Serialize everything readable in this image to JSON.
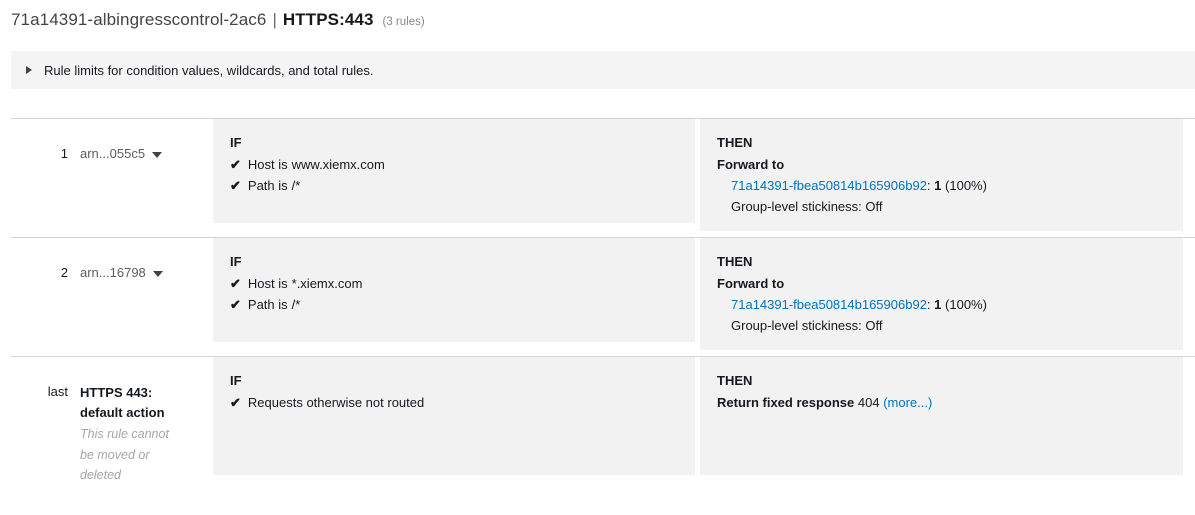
{
  "header": {
    "listener_name": "71a14391-albingresscontrol-2ac6",
    "separator": "|",
    "protocol_port": "HTTPS:443",
    "rules_count": "(3 rules)"
  },
  "info_banner": {
    "icon": "disclosure-triangle-icon",
    "text": "Rule limits for condition values, wildcards, and total rules."
  },
  "labels": {
    "if": "IF",
    "then": "THEN",
    "check_glyph": "✔"
  },
  "rules": [
    {
      "index": "1",
      "arn": "arn...055c5",
      "conditions": [
        {
          "key": "Host is",
          "value": "www.xiemx.com"
        },
        {
          "key": "Path is",
          "value": "/*"
        }
      ],
      "action_label": "Forward to",
      "target_group": "71a14391-fbea50814b165906b92",
      "target_colon": ":",
      "target_weight": "1",
      "target_percent": "(100%)",
      "stickiness": "Group-level stickiness: Off"
    },
    {
      "index": "2",
      "arn": "arn...16798",
      "conditions": [
        {
          "key": "Host is",
          "value": "*.xiemx.com"
        },
        {
          "key": "Path is",
          "value": "/*"
        }
      ],
      "action_label": "Forward to",
      "target_group": "71a14391-fbea50814b165906b92",
      "target_colon": ":",
      "target_weight": "1",
      "target_percent": "(100%)",
      "stickiness": "Group-level stickiness: Off"
    }
  ],
  "default_rule": {
    "index": "last",
    "title": "HTTPS 443: default action",
    "note": "This rule cannot be moved or deleted",
    "condition": "Requests otherwise not routed",
    "action_label": "Return fixed response",
    "action_code": "404",
    "more_link": "(more...)"
  },
  "colors": {
    "link": "#0073bb",
    "panel_bg": "#f2f2f2",
    "banner_bg": "#f4f4f4",
    "divider": "#d5d5d5",
    "muted_text": "#a6a6a6"
  }
}
